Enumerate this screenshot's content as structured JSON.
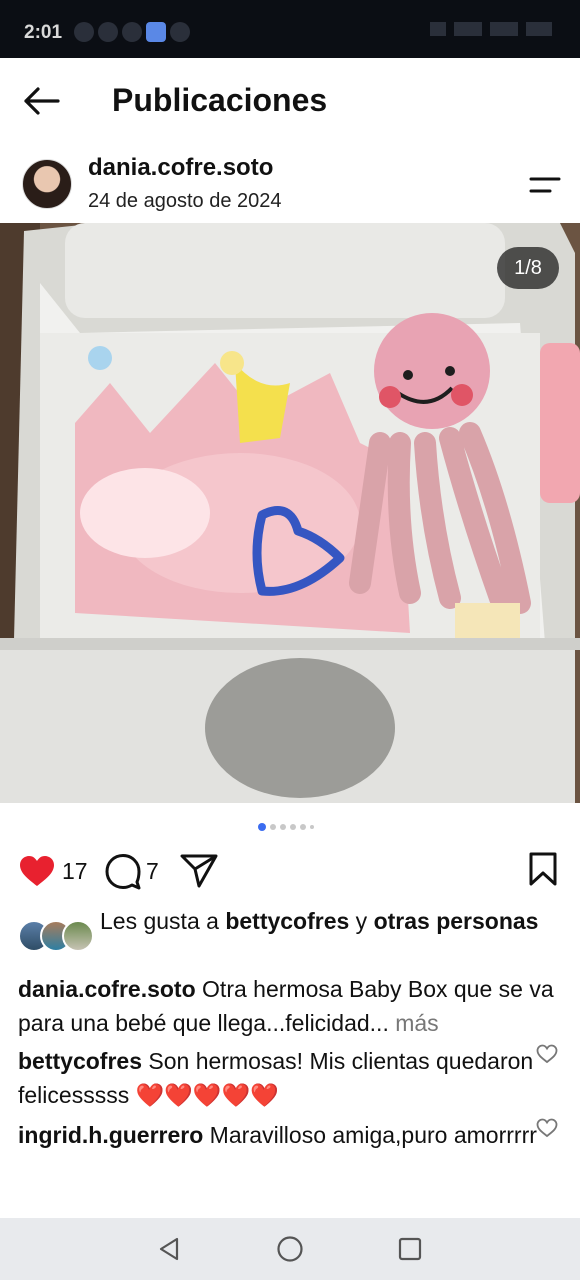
{
  "status_bar": {
    "time": "2:01"
  },
  "header": {
    "title": "Publicaciones"
  },
  "post": {
    "username": "dania.cofre.soto",
    "date": "24 de agosto de 2024",
    "image_counter": "1/8",
    "likes_count": "17",
    "comments_count": "7",
    "likes_prefix": "Les gusta a ",
    "likes_user": "bettycofres",
    "likes_mid": " y ",
    "likes_others": "otras personas",
    "caption_user": "dania.cofre.soto",
    "caption_text": " Otra hermosa Baby Box que se va para una bebé que llega...felicidad...",
    "caption_more": " más"
  },
  "comments": [
    {
      "user": "bettycofres",
      "text": " Son hermosas! Mis clientas quedaron felicesssss ❤️❤️❤️❤️❤️"
    },
    {
      "user": "ingrid.h.guerrero",
      "text": " Maravilloso amiga,puro amorrrrr"
    }
  ],
  "icons": {
    "back": "arrow-left-icon",
    "options": "options-icon",
    "like": "heart-filled-icon",
    "comment": "comment-bubble-icon",
    "share": "paper-plane-icon",
    "save": "bookmark-icon",
    "comment_like": "heart-outline-icon"
  },
  "colors": {
    "like_red": "#e8212f",
    "active_dot": "#3b6cf0",
    "nav_bg": "#e8eaed"
  }
}
